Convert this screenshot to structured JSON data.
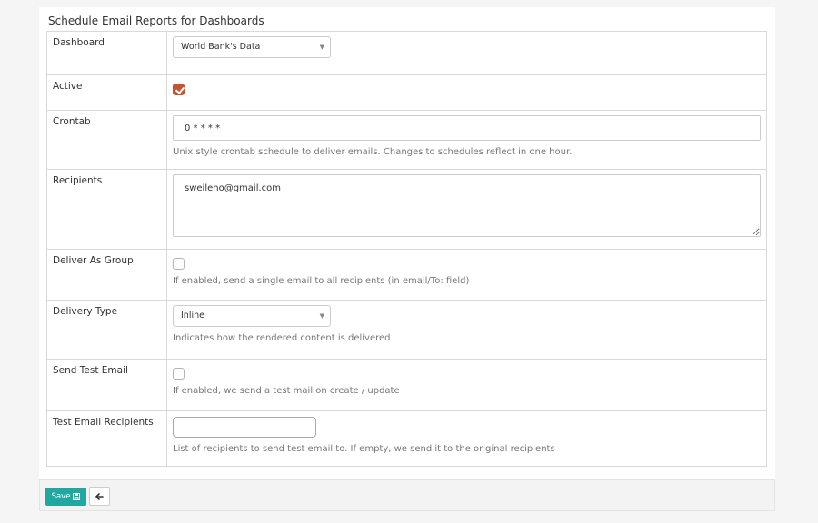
{
  "panel": {
    "title": "Schedule Email Reports for Dashboards"
  },
  "form": {
    "dashboard": {
      "label": "Dashboard",
      "value": "World Bank's Data"
    },
    "active": {
      "label": "Active",
      "checked": true
    },
    "crontab": {
      "label": "Crontab",
      "value": "0 * * * *",
      "help": "Unix style crontab schedule to deliver emails. Changes to schedules reflect in one hour."
    },
    "recipients": {
      "label": "Recipients",
      "value": "sweileho@gmail.com"
    },
    "deliver_as_group": {
      "label": "Deliver As Group",
      "checked": false,
      "help": "If enabled, send a single email to all recipients (in email/To: field)"
    },
    "delivery_type": {
      "label": "Delivery Type",
      "value": "Inline",
      "help": "Indicates how the rendered content is delivered"
    },
    "send_test_email": {
      "label": "Send Test Email",
      "checked": false,
      "help": "If enabled, we send a test mail on create / update"
    },
    "test_email_recipients": {
      "label": "Test Email Recipients",
      "value": "",
      "help": "List of recipients to send test email to. If empty, we send it to the original recipients"
    }
  },
  "footer": {
    "save_label": "Save"
  },
  "colors": {
    "accent": "#20a7a0",
    "checkbox_checked": "#c5532f"
  },
  "icons": {
    "save": "floppy-disk-icon",
    "back": "arrow-left-icon",
    "select_caret": "caret-down-icon"
  }
}
